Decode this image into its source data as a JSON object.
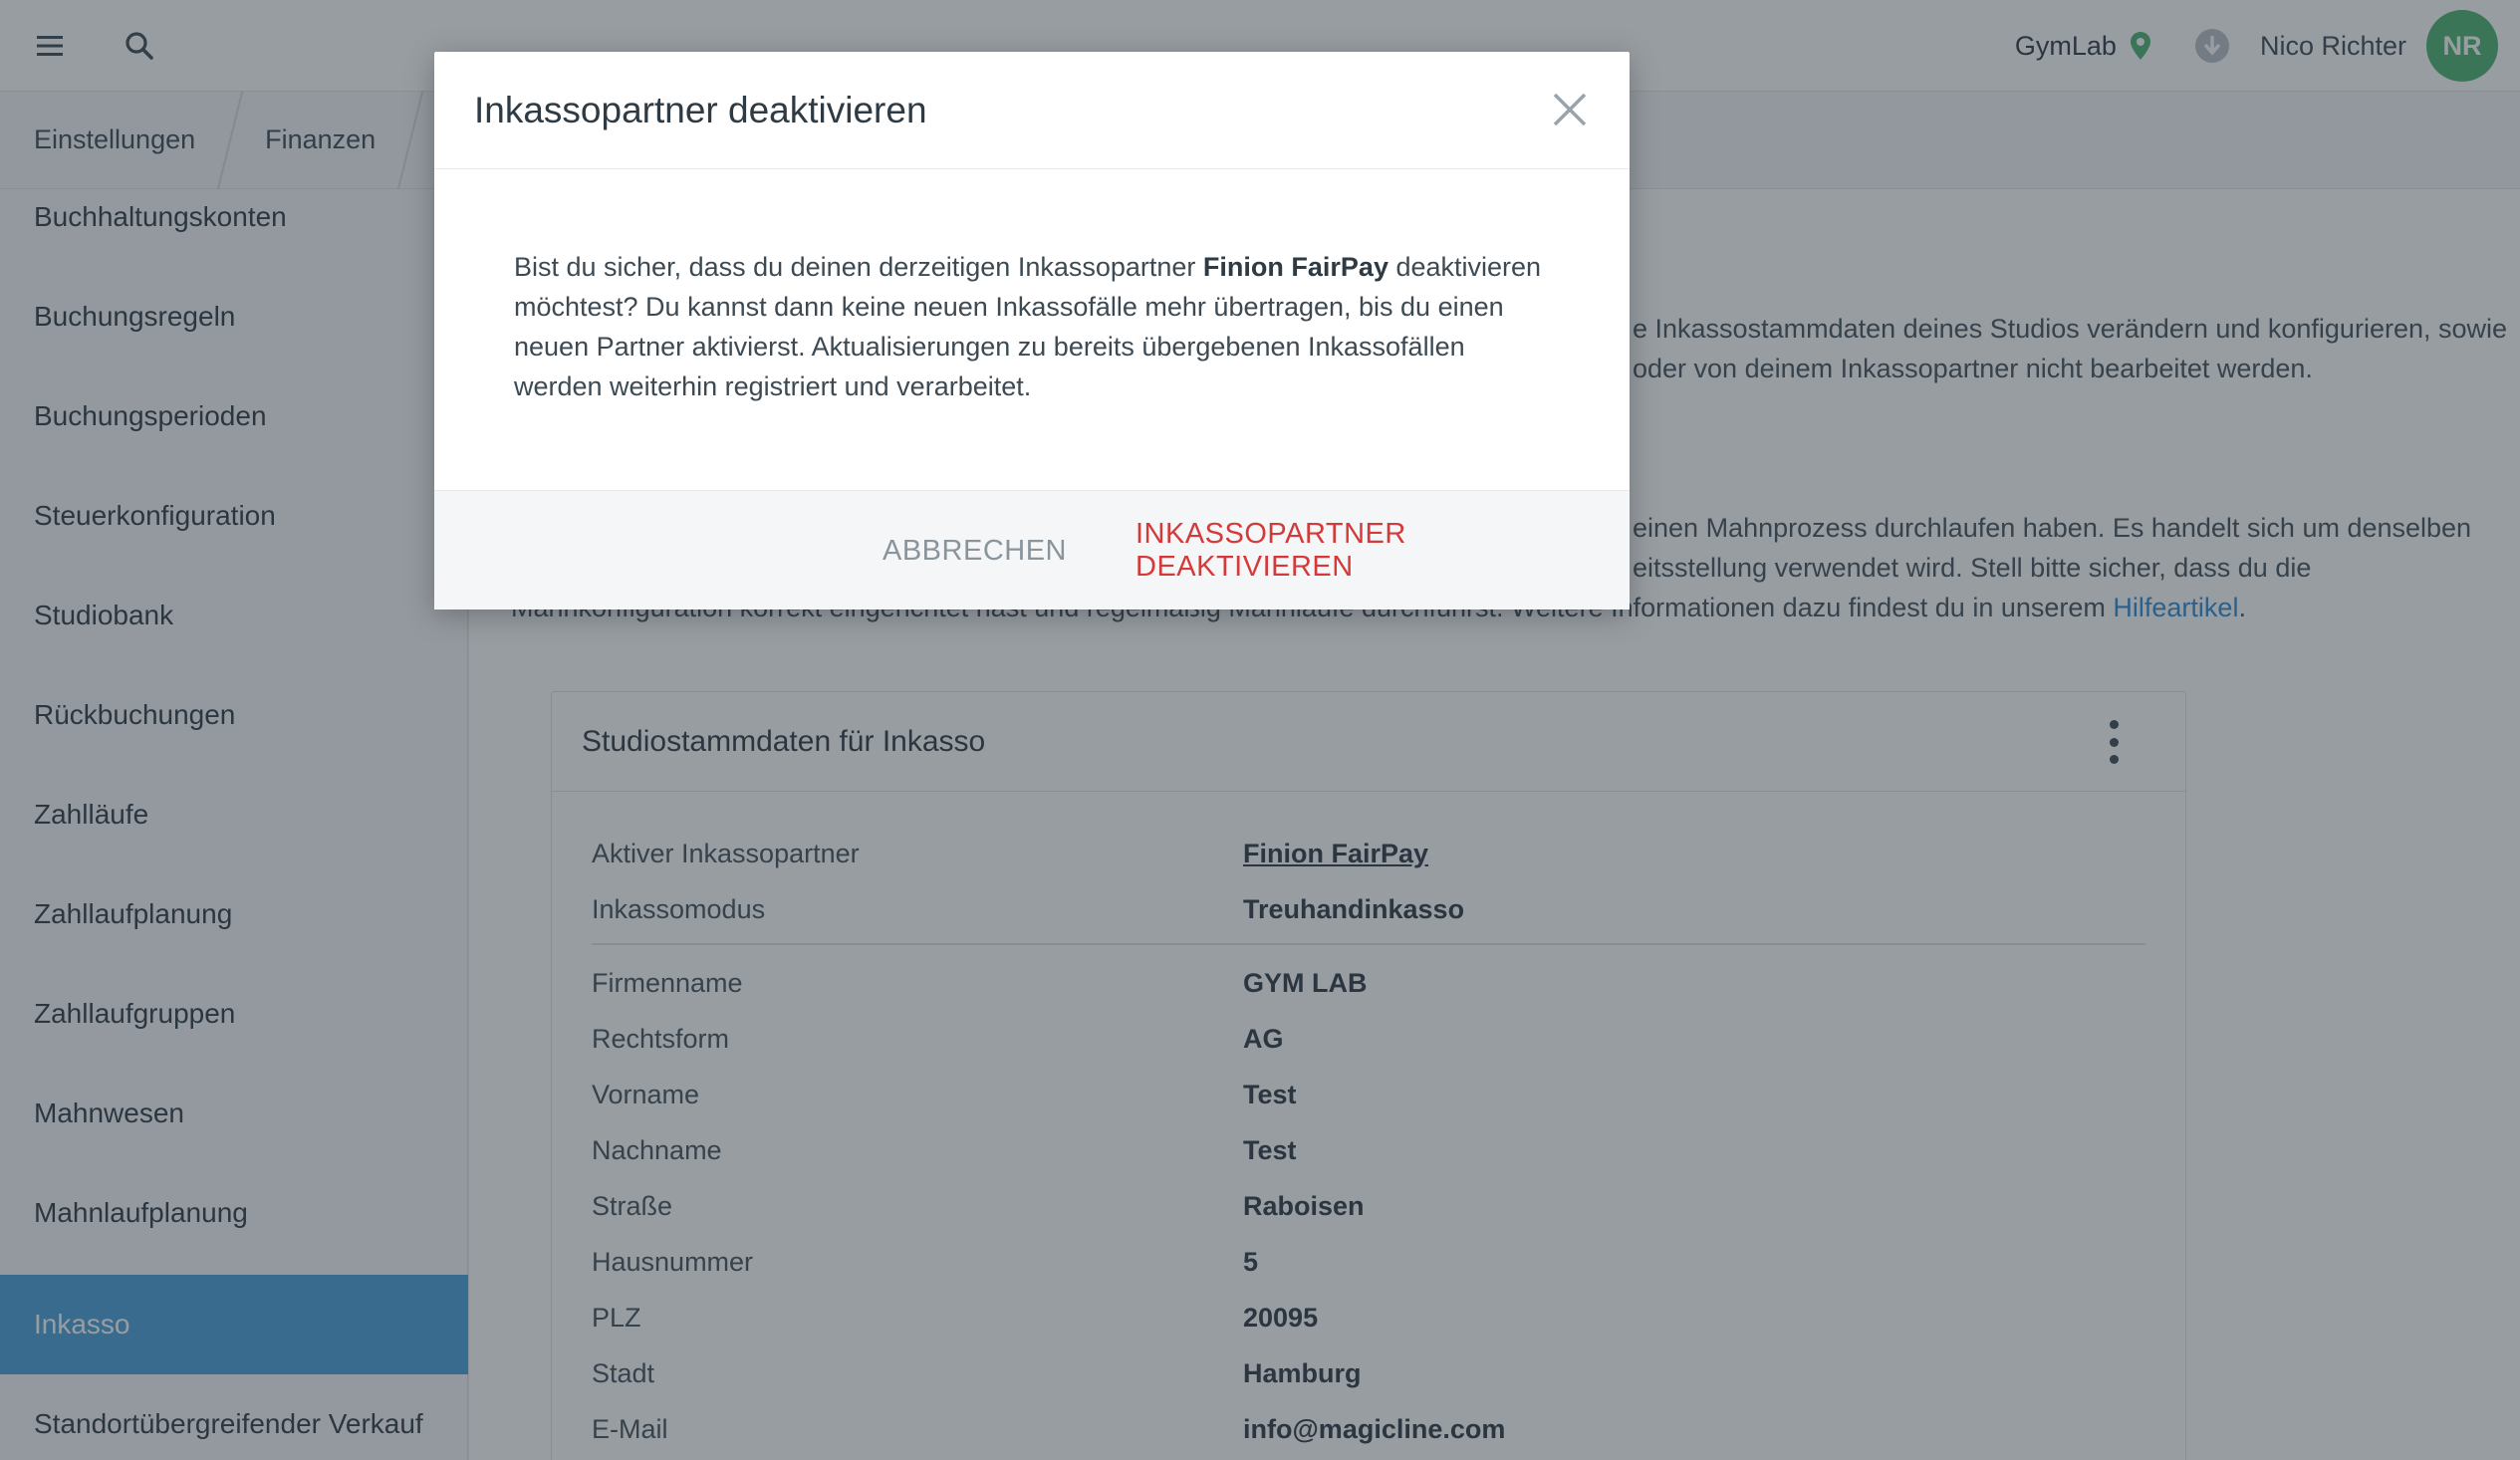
{
  "topbar": {
    "menu_icon": "hamburger-menu-icon",
    "search_icon": "search-icon",
    "studio": "GymLab",
    "pin_icon": "location-pin-icon",
    "download_icon": "download-icon",
    "user_name": "Nico Richter",
    "avatar_initials": "NR",
    "avatar_color": "#4cb372"
  },
  "breadcrumb": [
    "Einstellungen",
    "Finanzen"
  ],
  "sidebar": {
    "items": [
      "Buchhaltungskonten",
      "Buchungsregeln",
      "Buchungsperioden",
      "Steuerkonfiguration",
      "Studiobank",
      "Rückbuchungen",
      "Zahlläufe",
      "Zahllaufplanung",
      "Zahllaufgruppen",
      "Mahnwesen",
      "Mahnlaufplanung",
      "Inkasso",
      "Standortübergreifender Verkauf"
    ],
    "active": "Inkasso",
    "active_color": "#4a9fd8"
  },
  "main": {
    "para1_line1": "e Inkassostammdaten deines Studios verändern und konfigurieren, sowie",
    "para1_line2": "oder von deinem Inkassopartner nicht bearbeitet werden.",
    "para2_line1": "einen Mahnprozess durchlaufen haben. Es handelt sich um denselben",
    "para2_line2": "eitsstellung verwendet wird. Stell bitte sicher, dass du die",
    "para2_line3": "Mahnkonfiguration korrekt eingerichtet hast und regelmäßig Mahnläufe durchführst. Weitere Informationen dazu findest du in unserem",
    "help_link": "Hilfeartikel",
    "card": {
      "title": "Studiostammdaten für Inkasso",
      "menu_icon": "kebab-menu-icon",
      "rows": [
        {
          "label": "Aktiver Inkassopartner",
          "value": "Finion FairPay"
        },
        {
          "label": "Inkassomodus",
          "value": "Treuhandinkasso"
        },
        {
          "label": "Firmenname",
          "value": "GYM LAB"
        },
        {
          "label": "Rechtsform",
          "value": "AG"
        },
        {
          "label": "Vorname",
          "value": "Test"
        },
        {
          "label": "Nachname",
          "value": "Test"
        },
        {
          "label": "Straße",
          "value": "Raboisen"
        },
        {
          "label": "Hausnummer",
          "value": "5"
        },
        {
          "label": "PLZ",
          "value": "20095"
        },
        {
          "label": "Stadt",
          "value": "Hamburg"
        },
        {
          "label": "E-Mail",
          "value": "info@magicline.com"
        }
      ]
    }
  },
  "modal": {
    "title": "Inkassopartner deaktivieren",
    "close_icon": "close-icon",
    "body_before": "Bist du sicher, dass du deinen derzeitigen Inkassopartner ",
    "body_partner": "Finion FairPay",
    "body_after": " deaktivieren möchtest? Du kannst dann keine neuen Inkassofälle mehr übertragen, bis du einen neuen Partner aktivierst. Aktualisierungen zu bereits übergebenen Inkassofällen werden weiterhin registriert und verarbeitet.",
    "cancel_label": "ABBRECHEN",
    "confirm_label": "INKASSOPARTNER DEAKTIVIEREN",
    "confirm_color": "#d43a3a"
  }
}
